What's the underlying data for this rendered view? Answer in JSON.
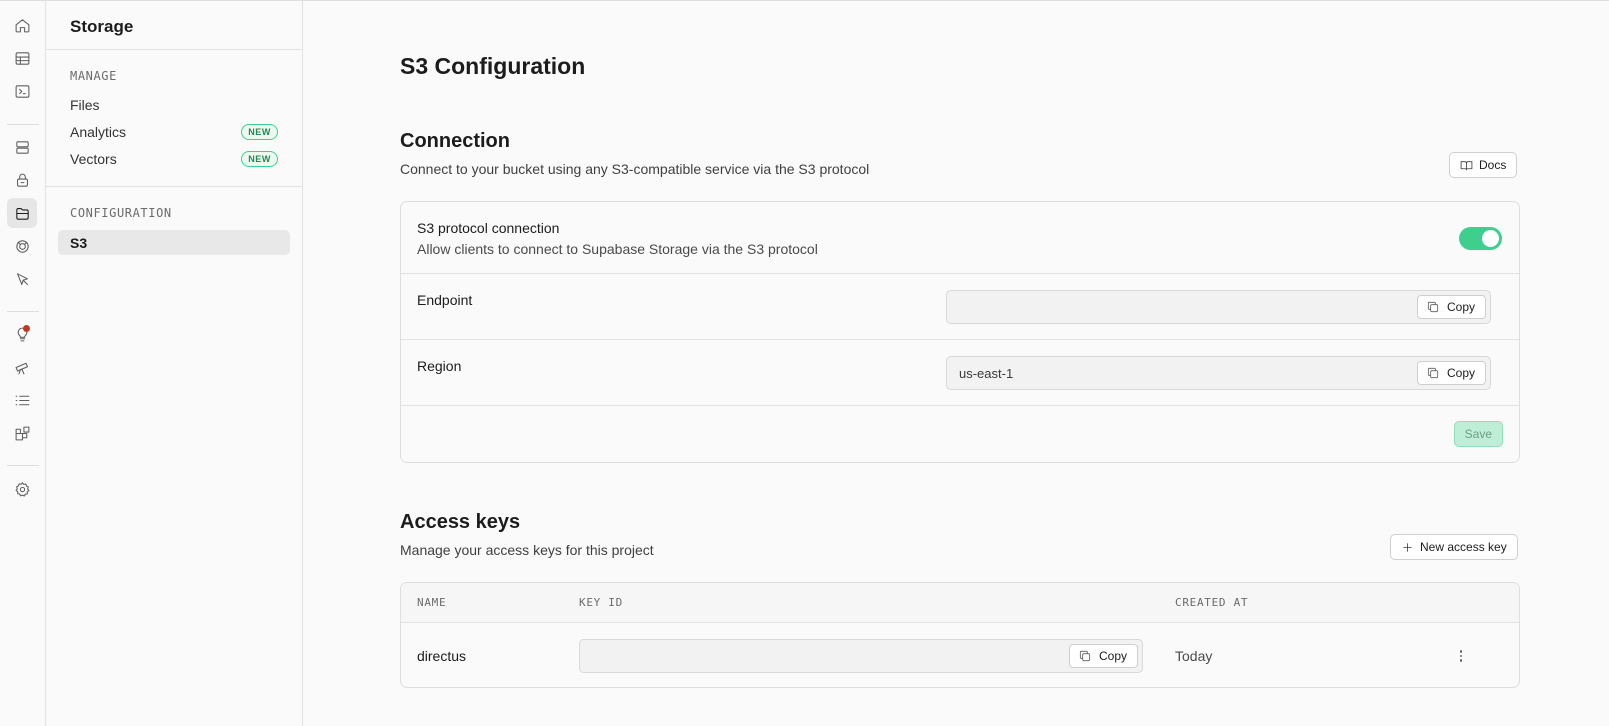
{
  "sidebar": {
    "title": "Storage",
    "manage_heading": "MANAGE",
    "manage_items": [
      {
        "label": "Files",
        "badge": ""
      },
      {
        "label": "Analytics",
        "badge": "NEW"
      },
      {
        "label": "Vectors",
        "badge": "NEW"
      }
    ],
    "config_heading": "CONFIGURATION",
    "config_items": [
      {
        "label": "S3",
        "active": true
      }
    ]
  },
  "rail": {
    "icons": [
      "home-icon",
      "table-editor-icon",
      "sql-editor-icon",
      "database-icon",
      "auth-icon",
      "storage-icon",
      "realtime-icon",
      "edge-functions-icon",
      "advisors-icon",
      "observability-icon",
      "logs-icon",
      "integrations-icon",
      "settings-icon"
    ],
    "active": "storage-icon"
  },
  "page": {
    "title": "S3 Configuration"
  },
  "connection": {
    "title": "Connection",
    "description": "Connect to your bucket using any S3-compatible service via the S3 protocol",
    "docs_label": "Docs",
    "protocol_label": "S3 protocol connection",
    "protocol_description": "Allow clients to connect to Supabase Storage via the S3 protocol",
    "protocol_enabled": true,
    "endpoint_label": "Endpoint",
    "endpoint_value": "",
    "region_label": "Region",
    "region_value": "us-east-1",
    "copy_label": "Copy",
    "save_label": "Save"
  },
  "access_keys": {
    "title": "Access keys",
    "description": "Manage your access keys for this project",
    "new_key_label": "New access key",
    "columns": [
      "NAME",
      "KEY ID",
      "CREATED AT"
    ],
    "rows": [
      {
        "name": "directus",
        "key_id": "",
        "created_at": "Today",
        "copy_label": "Copy"
      }
    ]
  },
  "colors": {
    "accent": "#3ecf8e",
    "badge_text": "#218a53",
    "notification": "#c5371d"
  }
}
